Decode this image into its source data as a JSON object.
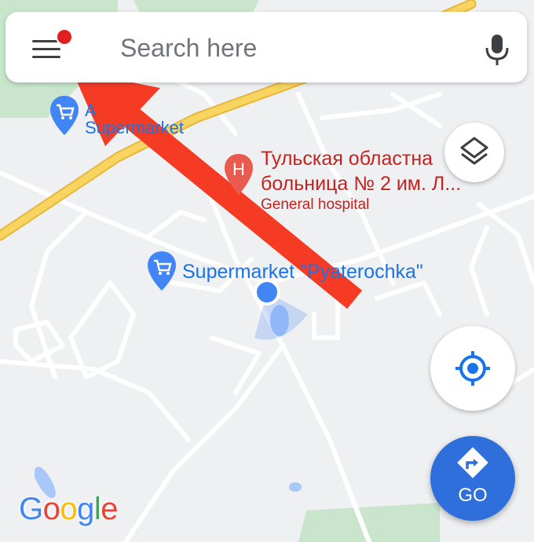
{
  "search": {
    "placeholder": "Search here"
  },
  "map": {
    "pois": [
      {
        "title": "Supermarket",
        "title_color": "#1a73e8"
      },
      {
        "title": "Тульская областная больница № 2 им. Л...",
        "line1": "Тульская областна",
        "line2": "больница № 2 им. Л...",
        "subtitle": "General hospital",
        "title_color": "#c5221f",
        "marker": "H"
      },
      {
        "title": "Supermarket \"Pyaterochka\"",
        "visible_text": "Supermarket \"Pyaterochka\"",
        "title_color": "#1a73e8"
      }
    ],
    "user_location": {
      "icon": "blue-dot"
    }
  },
  "controls": {
    "menu_icon": "hamburger-menu-icon",
    "mic_icon": "microphone-icon",
    "layers_icon": "layers-icon",
    "my_location_icon": "my-location-icon",
    "go_label": "GO",
    "directions_icon": "directions-turn-icon"
  },
  "logo": {
    "text": "Google"
  },
  "annotation": {
    "arrow_color": "#f53b23"
  },
  "colors": {
    "accent_blue": "#1a73e8",
    "highway": "#f7c948",
    "park": "#c8e6c9",
    "water": "#a8c7fa",
    "notification_red": "#e02020"
  }
}
